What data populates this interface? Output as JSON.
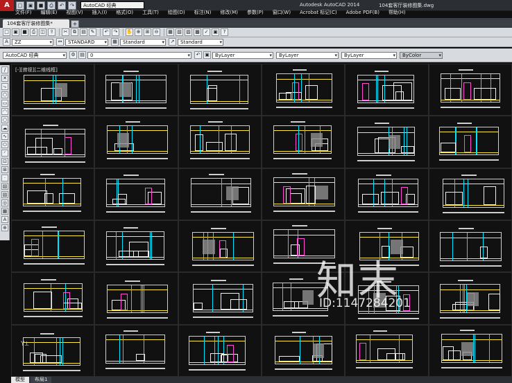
{
  "app": {
    "title": "Autodesk AutoCAD 2014",
    "file_name": "104套客厅装修图集.dwg",
    "workspace": "AutoCAD 经典",
    "logo": "A"
  },
  "menu": {
    "items": [
      "文件(F)",
      "编辑(E)",
      "视图(V)",
      "插入(I)",
      "格式(O)",
      "工具(T)",
      "绘图(D)",
      "标注(N)",
      "修改(M)",
      "参数(P)",
      "窗口(W)",
      "Acrobat 标记(C)",
      "Adobe PDF(B)",
      "帮助(H)"
    ]
  },
  "tabs": {
    "doc_tab": "104套客厅装修图集*",
    "new_tab": "+"
  },
  "style_toolbar": {
    "text_style": "ZZ",
    "dim_style": "STANDARD",
    "table_style": "Standard",
    "mleader_style": "Standard"
  },
  "layer_toolbar": {
    "workspace2": "AutoCAD 经典",
    "layer": "0",
    "color": "ByLayer",
    "linetype": "ByLayer",
    "lineweight": "ByLayer",
    "plotstyle": "ByColor"
  },
  "viewport": {
    "label": "[-][俯视][二维线框]"
  },
  "watermark": {
    "text": "知末",
    "id": "ID:1147284201"
  },
  "layout_tabs": [
    "模型",
    "布局1"
  ],
  "colors": {
    "yellow": "#ffeb3b",
    "cyan": "#00e5ff",
    "magenta": "#ff4fd8",
    "white": "#f0f0f0"
  }
}
